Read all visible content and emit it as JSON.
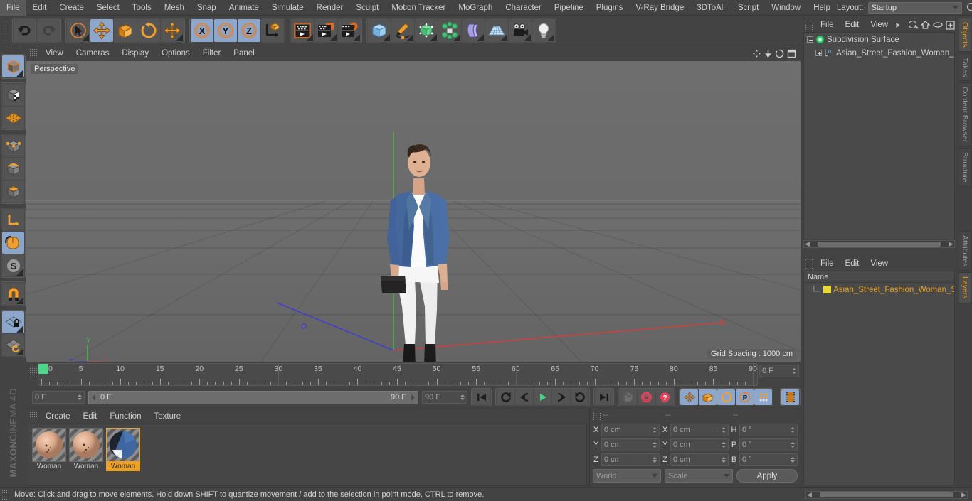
{
  "app": {
    "brand_maxon": "MAXON",
    "brand_c4d": "CINEMA 4D"
  },
  "menubar": {
    "items": [
      "File",
      "Edit",
      "Create",
      "Select",
      "Tools",
      "Mesh",
      "Snap",
      "Animate",
      "Simulate",
      "Render",
      "Sculpt",
      "Motion Tracker",
      "MoGraph",
      "Character",
      "Pipeline",
      "Plugins",
      "V-Ray Bridge",
      "3DToAll",
      "Script",
      "Window",
      "Help"
    ],
    "layout_label": "Layout:",
    "layout_value": "Startup",
    "search_icon": "search-icon"
  },
  "viewport": {
    "menu": [
      "View",
      "Cameras",
      "Display",
      "Options",
      "Filter",
      "Panel"
    ],
    "perspective_label": "Perspective",
    "grid_spacing": "Grid Spacing : 1000 cm",
    "axis": {
      "x": "X",
      "y": "Y",
      "z": "Z"
    },
    "colors": {
      "x_axis": "#d04040",
      "y_axis": "#3fbf3f",
      "z_axis": "#4040d0",
      "sky": "#6e6e6e",
      "ground": "#686868"
    }
  },
  "timeline": {
    "ticks": [
      0,
      5,
      10,
      15,
      20,
      25,
      30,
      35,
      40,
      45,
      50,
      55,
      60,
      65,
      70,
      75,
      80,
      85,
      90
    ],
    "current_frame": "0 F",
    "start_frame": "0 F",
    "end_frame": "90 F",
    "preview_end": "90 F",
    "range_field": "90 F"
  },
  "transport": {
    "buttons": [
      {
        "name": "go-to-start-button",
        "glyph": "start"
      },
      {
        "name": "play-backwards-button",
        "glyph": "rewind"
      },
      {
        "name": "step-back-button",
        "glyph": "stepback"
      },
      {
        "name": "play-forwards-button",
        "glyph": "play"
      },
      {
        "name": "step-forward-button",
        "glyph": "stepfwd"
      },
      {
        "name": "loop-button",
        "glyph": "loop"
      },
      {
        "name": "go-to-end-button",
        "glyph": "end"
      }
    ],
    "record_tools": [
      "autokey-button",
      "record-active-objects-button",
      "record-question-button"
    ],
    "key_tools": [
      "key-position-button",
      "key-scale-button",
      "key-rotation-button",
      "key-parameter-button",
      "key-point-level-button"
    ]
  },
  "material_manager": {
    "menu": [
      "Create",
      "Edit",
      "Function",
      "Texture"
    ],
    "materials": [
      {
        "label": "Woman",
        "selected": false,
        "kind": "skin"
      },
      {
        "label": "Woman",
        "selected": false,
        "kind": "skin"
      },
      {
        "label": "Woman",
        "selected": true,
        "kind": "cloth"
      }
    ]
  },
  "coordinates": {
    "header": [
      "--",
      "--",
      "--"
    ],
    "rows": [
      {
        "pos_label": "X",
        "pos_value": "0 cm",
        "size_label": "X",
        "size_value": "0 cm",
        "rot_label": "H",
        "rot_value": "0 °"
      },
      {
        "pos_label": "Y",
        "pos_value": "0 cm",
        "size_label": "Y",
        "size_value": "0 cm",
        "rot_label": "P",
        "rot_value": "0 °"
      },
      {
        "pos_label": "Z",
        "pos_value": "0 cm",
        "size_label": "Z",
        "size_value": "0 cm",
        "rot_label": "B",
        "rot_value": "0 °"
      }
    ],
    "system": "World",
    "mode": "Scale",
    "apply": "Apply"
  },
  "object_manager": {
    "menu": [
      "File",
      "Edit",
      "View"
    ],
    "icons": [
      "search-icon",
      "home-icon",
      "ellipse-icon",
      "frame-icon"
    ],
    "tree": [
      {
        "label": "Subdivision Surface",
        "depth": 0,
        "icon": "subdivision-surface-icon",
        "expanded": true
      },
      {
        "label": "Asian_Street_Fashion_Woman_St",
        "depth": 1,
        "icon": "polygon-object-icon",
        "expanded": false,
        "badge": "0"
      }
    ]
  },
  "layer_manager": {
    "menu": [
      "File",
      "Edit",
      "View"
    ],
    "column_header": "Name",
    "rows": [
      {
        "label": "Asian_Street_Fashion_Woman_Sta",
        "color": "#e8d832",
        "text_color": "#e8a020"
      }
    ]
  },
  "side_tabs_top": [
    "Objects",
    "Takes",
    "Content Browser",
    "Structure"
  ],
  "side_tabs_bottom": [
    "Attributes",
    "Layers"
  ],
  "active_side_tabs": [
    "Objects",
    "Layers"
  ],
  "statusbar": {
    "text": "Move: Click and drag to move elements. Hold down SHIFT to quantize movement / add to the selection in point mode, CTRL to remove."
  },
  "toolbar": {
    "groups": [
      {
        "name": "history",
        "buttons": [
          {
            "name": "undo-button"
          },
          {
            "name": "redo-button"
          }
        ]
      },
      {
        "name": "tools",
        "buttons": [
          {
            "name": "live-selection-tool"
          },
          {
            "name": "move-tool",
            "active": true
          },
          {
            "name": "scale-tool"
          },
          {
            "name": "rotate-tool"
          },
          {
            "name": "move-axis-tool"
          }
        ]
      },
      {
        "name": "axis-locks",
        "buttons": [
          {
            "name": "lock-x-axis",
            "active": true
          },
          {
            "name": "lock-y-axis",
            "active": true
          },
          {
            "name": "lock-z-axis",
            "active": true
          },
          {
            "name": "world-object-coordinates"
          }
        ]
      },
      {
        "name": "render",
        "buttons": [
          {
            "name": "render-view-button"
          },
          {
            "name": "render-to-picture-viewer-button"
          },
          {
            "name": "render-settings-button"
          }
        ]
      },
      {
        "name": "create",
        "buttons": [
          {
            "name": "add-cube-button"
          },
          {
            "name": "add-spline-button"
          },
          {
            "name": "add-nurbs-button"
          },
          {
            "name": "add-array-button"
          },
          {
            "name": "add-bend-deformer-button"
          },
          {
            "name": "add-floor-button"
          },
          {
            "name": "add-camera-button"
          },
          {
            "name": "add-light-button"
          }
        ]
      }
    ]
  },
  "left_toolbar": {
    "buttons": [
      {
        "name": "make-editable-button"
      },
      {
        "name": "model-mode-button",
        "active": true
      },
      {
        "name": "texture-mode-button"
      },
      {
        "name": "uv-mesh-mode-button"
      },
      {
        "name": "points-mode-button"
      },
      {
        "name": "edges-mode-button"
      },
      {
        "name": "polygons-mode-button"
      },
      {
        "name": "axis-modify-button"
      },
      {
        "name": "enable-axis-button",
        "active": true
      },
      {
        "name": "soft-selection-button"
      },
      {
        "name": "snap-magnet-button"
      },
      {
        "name": "lock-workplane-button",
        "active": true
      },
      {
        "name": "workplane-rotate-button"
      }
    ]
  }
}
